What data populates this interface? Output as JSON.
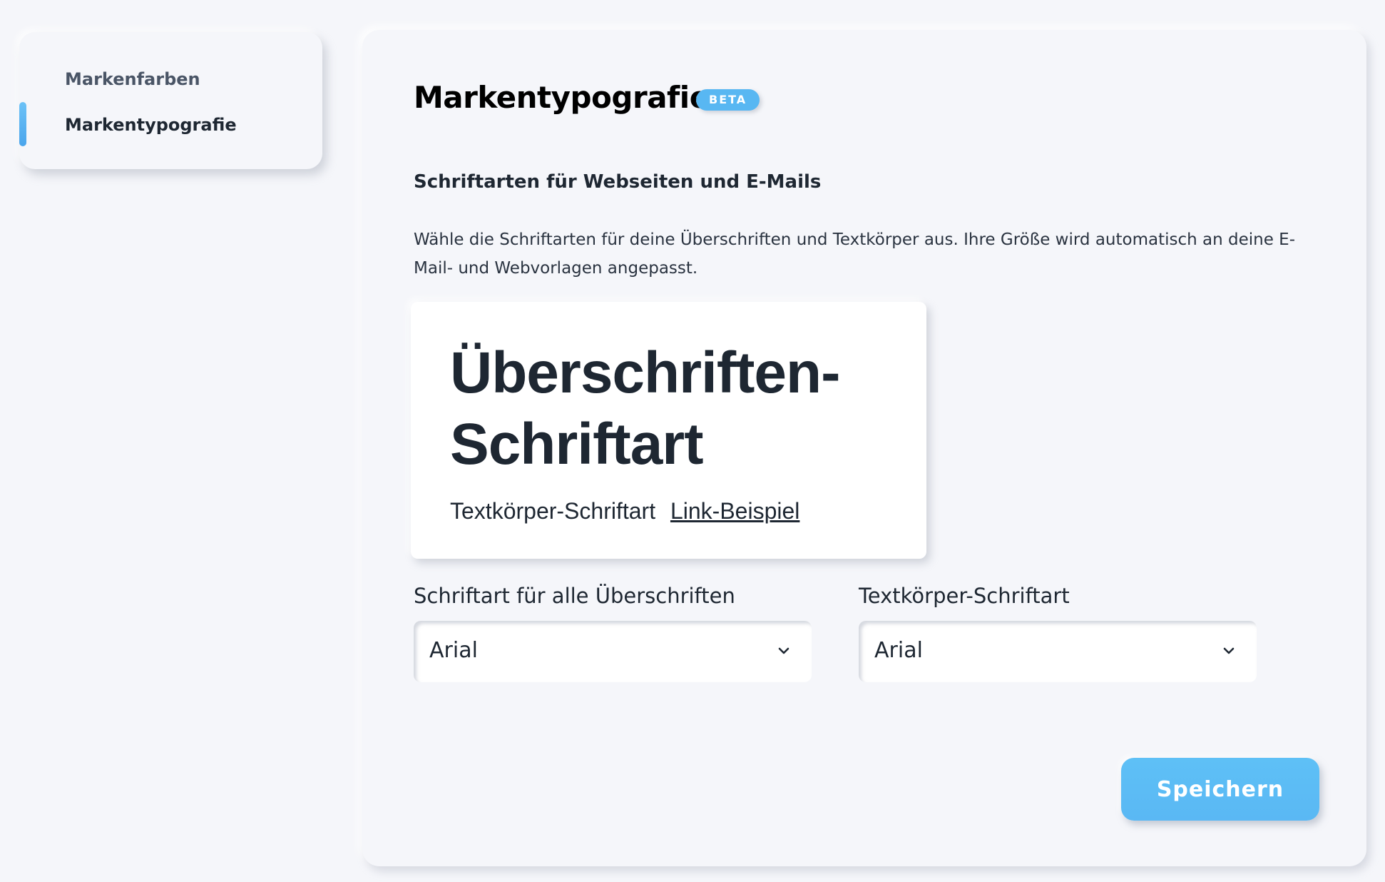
{
  "sidebar": {
    "items": [
      {
        "label": "Markenfarben",
        "active": false
      },
      {
        "label": "Markentypografie",
        "active": true
      }
    ]
  },
  "main": {
    "title": "Markentypografie",
    "badge": "BETA",
    "section_title": "Schriftarten für Webseiten und E-Mails",
    "description": "Wähle die Schriftarten für deine Überschriften und Textkörper aus. Ihre Größe wird automatisch an deine E-Mail- und Webvorlagen angepasst.",
    "preview": {
      "heading": "Überschriften-Schriftart",
      "body": "Textkörper-Schriftart",
      "link": "Link-Beispiel"
    },
    "heading_font": {
      "label": "Schriftart für alle Überschriften",
      "value": "Arial"
    },
    "body_font": {
      "label": "Textkörper-Schriftart",
      "value": "Arial"
    },
    "save_label": "Speichern"
  },
  "colors": {
    "background": "#f5f6fa",
    "accent": "#58b7f2",
    "text": "#1e2732"
  }
}
